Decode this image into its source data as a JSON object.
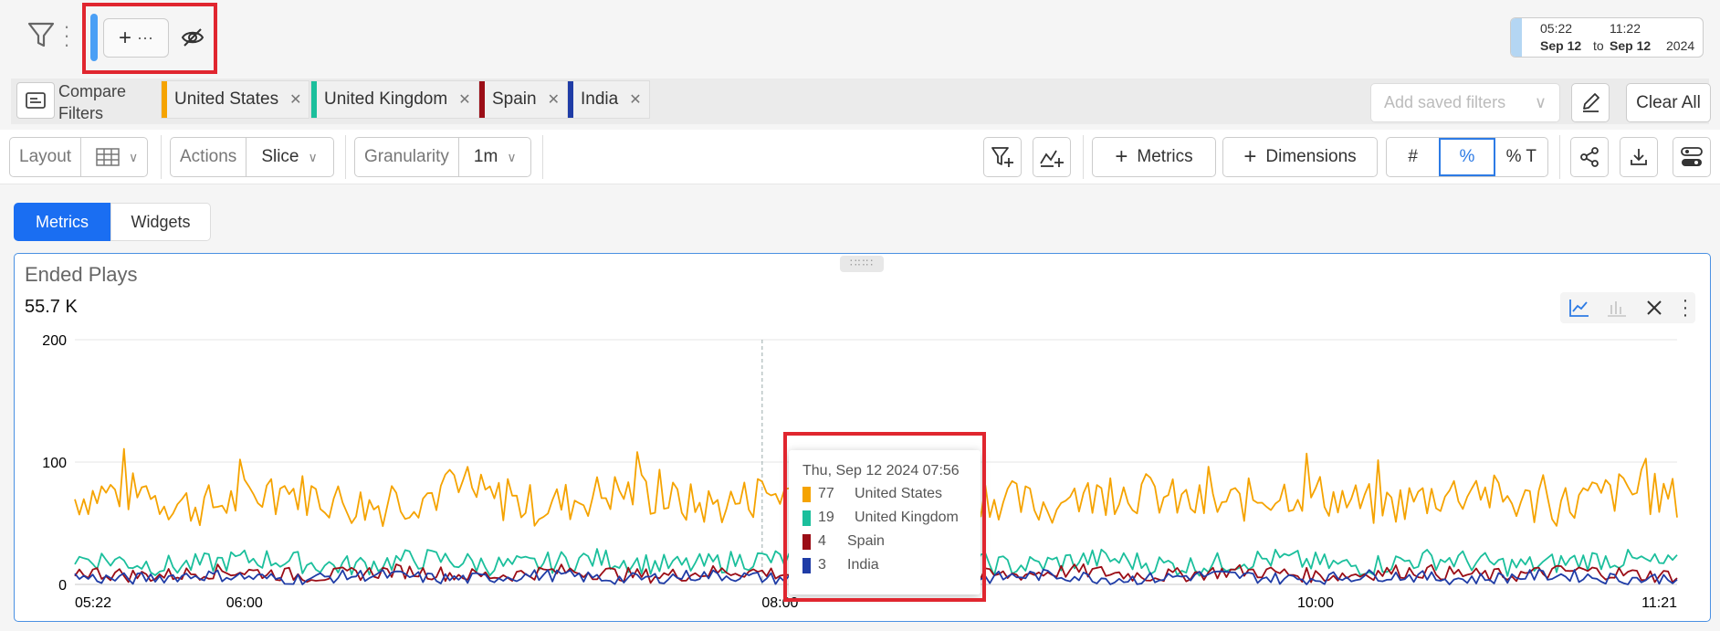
{
  "header": {
    "date_range": {
      "start_time": "05:22",
      "start_date": "Sep 12",
      "to": "to",
      "end_time": "11:22",
      "end_date": "Sep 12",
      "year": "2024"
    }
  },
  "compare_filters": {
    "label": "Compare Filters",
    "chips": [
      {
        "label": "United States",
        "color": "#f5a300"
      },
      {
        "label": "United Kingdom",
        "color": "#1bbf9c"
      },
      {
        "label": "Spain",
        "color": "#9b0d16"
      },
      {
        "label": "India",
        "color": "#1f3ca6"
      }
    ],
    "saved_filters_placeholder": "Add saved filters",
    "clear_all": "Clear All"
  },
  "toolbar": {
    "layout_label": "Layout",
    "actions_label": "Actions",
    "actions_value": "Slice",
    "granularity_label": "Granularity",
    "granularity_value": "1m",
    "metrics_btn": "Metrics",
    "dimensions_btn": "Dimensions",
    "count_mode": "#",
    "percent_mode": "%",
    "percent_total_mode": "% T"
  },
  "tabs": {
    "metrics": "Metrics",
    "widgets": "Widgets"
  },
  "panel": {
    "title": "Ended Plays",
    "total": "55.7 K"
  },
  "chart_data": {
    "type": "line",
    "title": "Ended Plays",
    "y_ticks": [
      "200",
      "100",
      "0"
    ],
    "ylim": [
      0,
      200
    ],
    "x_ticks": [
      "05:22",
      "06:00",
      "08:00",
      "10:00",
      "11:21"
    ],
    "x_range_minutes": [
      322,
      681
    ],
    "series": [
      {
        "name": "United States",
        "color": "#f5a300",
        "base": 70,
        "amp": 18
      },
      {
        "name": "United Kingdom",
        "color": "#1bbf9c",
        "base": 18,
        "amp": 9
      },
      {
        "name": "Spain",
        "color": "#9b0d16",
        "base": 9,
        "amp": 6
      },
      {
        "name": "India",
        "color": "#1f3ca6",
        "base": 6,
        "amp": 5
      }
    ],
    "hover_x_minute": 476
  },
  "tooltip": {
    "title": "Thu, Sep 12 2024 07:56",
    "rows": [
      {
        "value": "77",
        "label": "United States",
        "color": "#f5a300"
      },
      {
        "value": "19",
        "label": "United Kingdom",
        "color": "#1bbf9c"
      },
      {
        "value": "4",
        "label": "Spain",
        "color": "#9b0d16"
      },
      {
        "value": "3",
        "label": "India",
        "color": "#1f3ca6"
      }
    ]
  },
  "icons": {
    "filter": "funnel-icon",
    "hide": "eye-off-icon",
    "layout": "grid-layout-icon",
    "line_chart": "line-chart-icon",
    "bar_chart": "bar-chart-icon",
    "close": "close-icon",
    "share": "share-icon",
    "download": "download-icon",
    "toggle": "toggle-icon"
  }
}
